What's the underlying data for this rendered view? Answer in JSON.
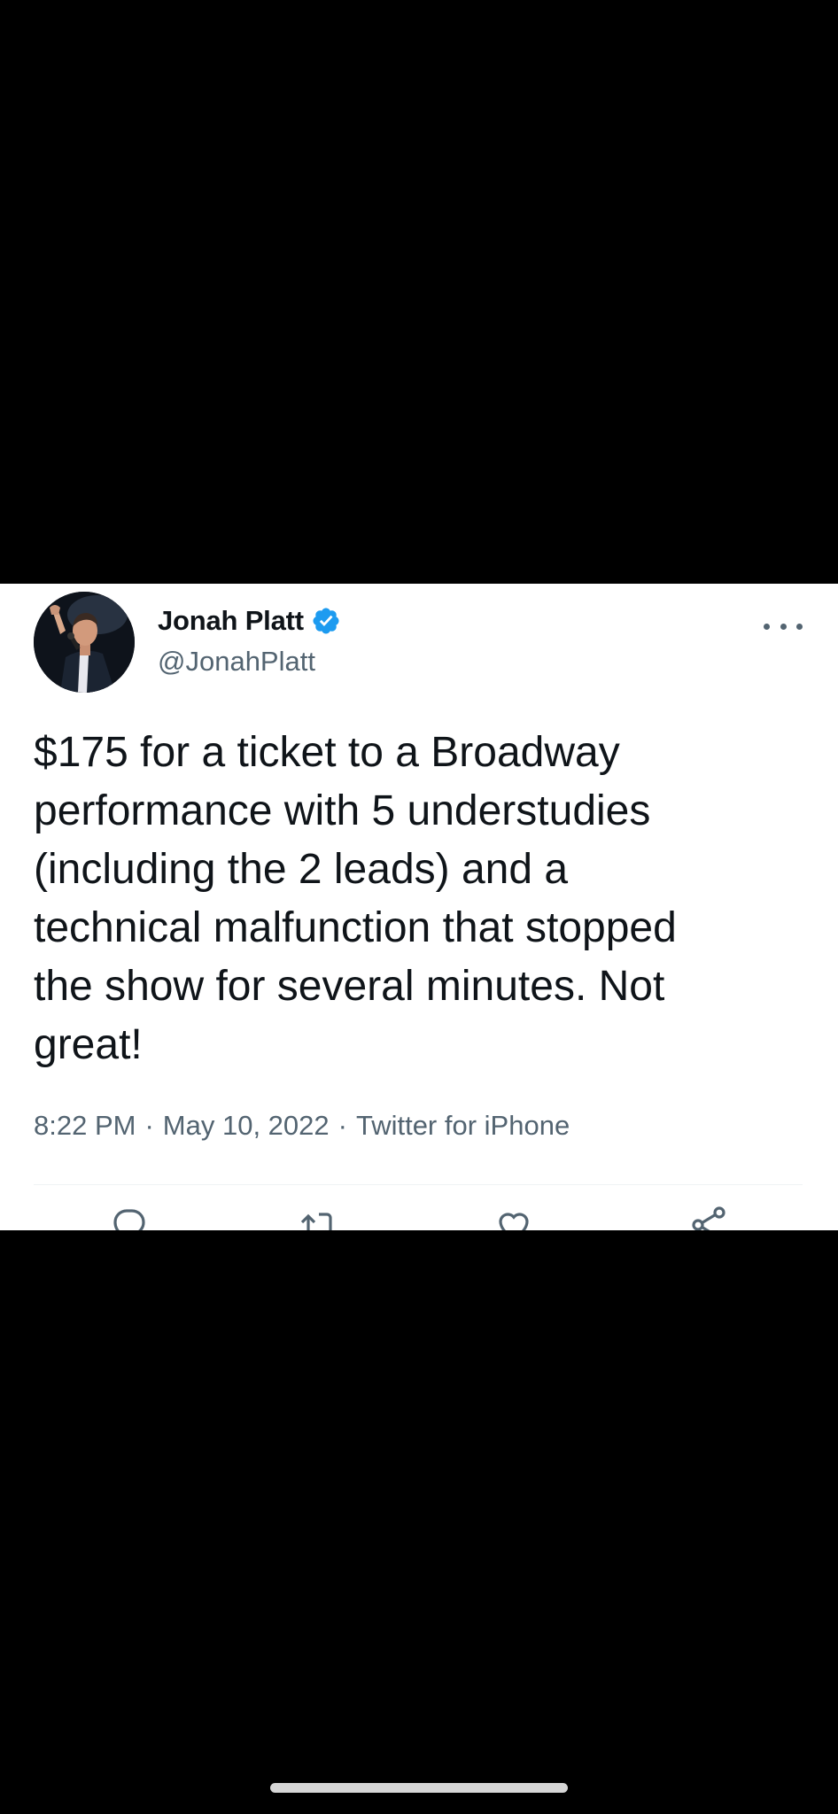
{
  "tweet": {
    "author": {
      "display_name": "Jonah Platt",
      "handle": "@JonahPlatt",
      "verified": true,
      "avatar": "profile-photo"
    },
    "text": "$175 for a ticket to a Broadway\nperformance with 5 understudies\n(including the 2 leads) and a\ntechnical malfunction that stopped\nthe show for several minutes. Not\ngreat!",
    "time": "8:22 PM",
    "date": "May 10, 2022",
    "source": "Twitter for iPhone",
    "separator": "·",
    "icons": {
      "more": "more-dots-icon",
      "verified": "verified-badge-icon",
      "reply": "reply-icon",
      "retweet": "retweet-icon",
      "like": "like-icon",
      "share": "share-icon"
    }
  },
  "colors": {
    "text_primary": "#0f1419",
    "text_secondary": "#536471",
    "verified_blue": "#1d9bf0",
    "background": "#ffffff",
    "letterbox": "#000000"
  }
}
